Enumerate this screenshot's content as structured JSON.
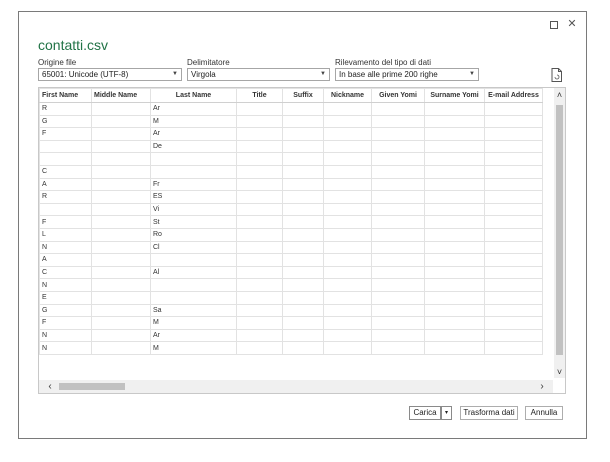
{
  "window": {
    "title": "contatti.csv",
    "maximize_glyph": "",
    "close_glyph": "✕"
  },
  "file_origin": {
    "label": "Origine file",
    "value": "65001: Unicode (UTF-8)"
  },
  "delimiter": {
    "label": "Delimitatore",
    "value": "Virgola"
  },
  "datatype_detection": {
    "label": "Rilevamento del tipo di dati",
    "value": "In base alle prime 200 righe"
  },
  "preview_icon": "document-refresh-icon",
  "table": {
    "columns": [
      "First Name",
      "Middle Name",
      "Last Name",
      "Title",
      "Suffix",
      "Nickname",
      "Given Yomi",
      "Surname Yomi",
      "E-mail Address"
    ],
    "rows": [
      [
        "R",
        "",
        "Ar",
        "",
        "",
        "",
        "",
        "",
        ""
      ],
      [
        "G",
        "",
        "M",
        "",
        "",
        "",
        "",
        "",
        ""
      ],
      [
        "F",
        "",
        "Ar",
        "",
        "",
        "",
        "",
        "",
        ""
      ],
      [
        "",
        "",
        "De",
        "",
        "",
        "",
        "",
        "",
        ""
      ],
      [
        "",
        "",
        "",
        "",
        "",
        "",
        "",
        "",
        ""
      ],
      [
        "C",
        "",
        "",
        "",
        "",
        "",
        "",
        "",
        ""
      ],
      [
        "A",
        "",
        "Fr",
        "",
        "",
        "",
        "",
        "",
        ""
      ],
      [
        "R",
        "",
        "ES",
        "",
        "",
        "",
        "",
        "",
        ""
      ],
      [
        "",
        "",
        "Vi",
        "",
        "",
        "",
        "",
        "",
        ""
      ],
      [
        "F",
        "",
        "St",
        "",
        "",
        "",
        "",
        "",
        ""
      ],
      [
        "L",
        "",
        "Ro",
        "",
        "",
        "",
        "",
        "",
        ""
      ],
      [
        "N",
        "",
        "Cl",
        "",
        "",
        "",
        "",
        "",
        ""
      ],
      [
        "A",
        "",
        "",
        "",
        "",
        "",
        "",
        "",
        ""
      ],
      [
        "C",
        "",
        "Al",
        "",
        "",
        "",
        "",
        "",
        ""
      ],
      [
        "N",
        "",
        "",
        "",
        "",
        "",
        "",
        "",
        ""
      ],
      [
        "E",
        "",
        "",
        "",
        "",
        "",
        "",
        "",
        ""
      ],
      [
        "G",
        "",
        "Sa",
        "",
        "",
        "",
        "",
        "",
        ""
      ],
      [
        "F",
        "",
        "M",
        "",
        "",
        "",
        "",
        "",
        ""
      ],
      [
        "N",
        "",
        "Ar",
        "",
        "",
        "",
        "",
        "",
        ""
      ],
      [
        "N",
        "",
        "M",
        "",
        "",
        "",
        "",
        "",
        ""
      ]
    ]
  },
  "scroll": {
    "up": "˄",
    "down": "˅",
    "left": "‹",
    "right": "›"
  },
  "buttons": {
    "load": "Carica",
    "load_dropdown": "▾",
    "transform": "Trasforma dati",
    "cancel": "Annulla"
  },
  "colors": {
    "title": "#217346",
    "border": "#7a7a7a"
  }
}
